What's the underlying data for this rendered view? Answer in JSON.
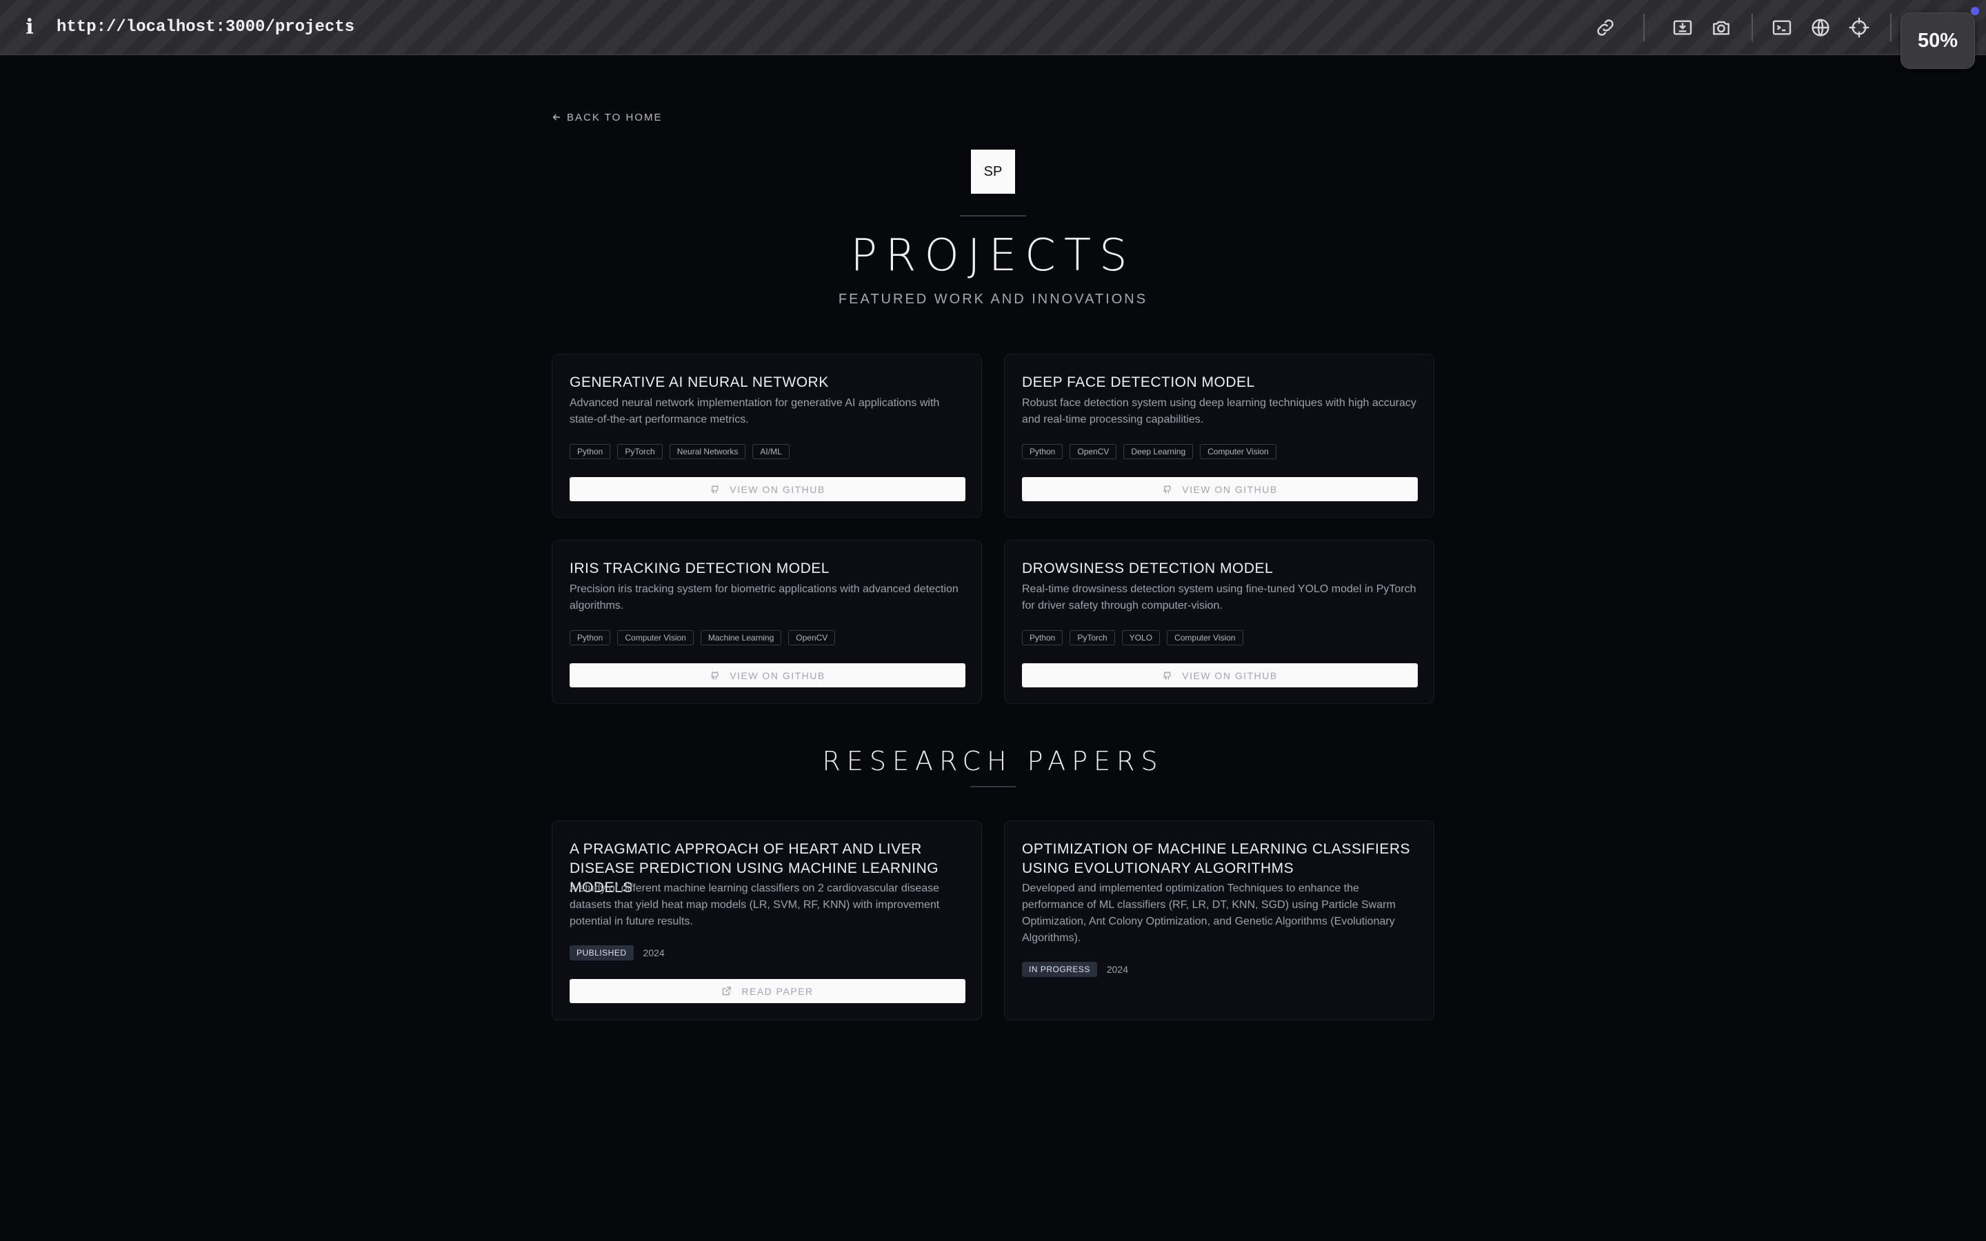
{
  "browser": {
    "url": "http://localhost:3000/projects",
    "zoom": "50%",
    "info_icon": "i",
    "icons": [
      "link-icon",
      "download-window-icon",
      "camera-icon",
      "terminal-icon",
      "globe-icon",
      "crosshair-icon"
    ]
  },
  "page": {
    "back_label": "BACK TO HOME",
    "logo_text": "SP",
    "title": "PROJECTS",
    "subtitle": "FEATURED WORK AND INNOVATIONS"
  },
  "projects": [
    {
      "title": "GENERATIVE AI NEURAL NETWORK",
      "description": "Advanced neural network implementation for generative AI applications with state-of-the-art performance metrics.",
      "tags": [
        "Python",
        "PyTorch",
        "Neural Networks",
        "AI/ML"
      ],
      "button": "VIEW ON GITHUB"
    },
    {
      "title": "DEEP FACE DETECTION MODEL",
      "description": "Robust face detection system using deep learning techniques with high accuracy and real-time processing capabilities.",
      "tags": [
        "Python",
        "OpenCV",
        "Deep Learning",
        "Computer Vision"
      ],
      "button": "VIEW ON GITHUB"
    },
    {
      "title": "IRIS TRACKING DETECTION MODEL",
      "description": "Precision iris tracking system for biometric applications with advanced detection algorithms.",
      "tags": [
        "Python",
        "Computer Vision",
        "Machine Learning",
        "OpenCV"
      ],
      "button": "VIEW ON GITHUB"
    },
    {
      "title": "DROWSINESS DETECTION MODEL",
      "description": "Real-time drowsiness detection system using fine-tuned YOLO model in PyTorch for driver safety through computer-vision.",
      "tags": [
        "Python",
        "PyTorch",
        "YOLO",
        "Computer Vision"
      ],
      "button": "VIEW ON GITHUB"
    }
  ],
  "research": {
    "title": "RESEARCH PAPERS",
    "papers": [
      {
        "title": "A PRAGMATIC APPROACH OF HEART AND LIVER DISEASE PREDICTION USING MACHINE LEARNING MODELS",
        "description": "A study of different machine learning classifiers on 2 cardiovascular disease datasets that yield heat map models (LR, SVM, RF, KNN) with improvement potential in future results.",
        "status": "PUBLISHED",
        "year": "2024",
        "button": "READ PAPER"
      },
      {
        "title": "OPTIMIZATION OF MACHINE LEARNING CLASSIFIERS USING EVOLUTIONARY ALGORITHMS",
        "description": "Developed and implemented optimization Techniques to enhance the performance of ML classifiers (RF, LR, DT, KNN, SGD) using Particle Swarm Optimization, Ant Colony Optimization, and Genetic Algorithms (Evolutionary Algorithms).",
        "status": "IN PROGRESS",
        "year": "2024"
      }
    ]
  }
}
